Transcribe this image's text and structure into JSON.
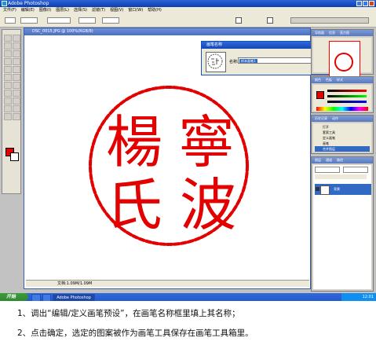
{
  "window": {
    "title": "Adobe Photoshop"
  },
  "menu": [
    "文件(F)",
    "编辑(E)",
    "图像(I)",
    "图层(L)",
    "选择(S)",
    "滤镜(T)",
    "视图(V)",
    "窗口(W)",
    "帮助(H)"
  ],
  "document": {
    "title": "DSC_0015.JPG @ 100%(RGB/8)",
    "status": "文档:1.09M/1.09M"
  },
  "dialog": {
    "title": "画笔名称",
    "name_label": "名称:",
    "name_value": "样本画笔1",
    "ok_label": "好",
    "cancel_label": "取消"
  },
  "panels": {
    "navigator": {
      "tabs": [
        "导航器",
        "信息",
        "直方图"
      ]
    },
    "color": {
      "tabs": [
        "颜色",
        "色板",
        "样式"
      ]
    },
    "history": {
      "tabs": [
        "历史记录",
        "动作"
      ],
      "items": [
        "打开",
        "套索工具",
        "定义画笔",
        "画笔",
        "合并图层"
      ]
    },
    "layers": {
      "tabs": [
        "图层",
        "通道",
        "路径"
      ],
      "layer_name": "背景"
    }
  },
  "taskbar": {
    "start": "开始",
    "tasks": [
      "Adobe Photoshop"
    ],
    "clock": "12:01"
  },
  "seal": {
    "glyphs": [
      "寧",
      "波",
      "楊",
      "氏"
    ],
    "color": "#e30000"
  },
  "instructions": [
    "1、调出“编辑/定义画笔预设”，在画笔名称框里填上其名称；",
    "2、点击确定，选定的图案被作为画笔工具保存在画笔工具箱里。"
  ]
}
